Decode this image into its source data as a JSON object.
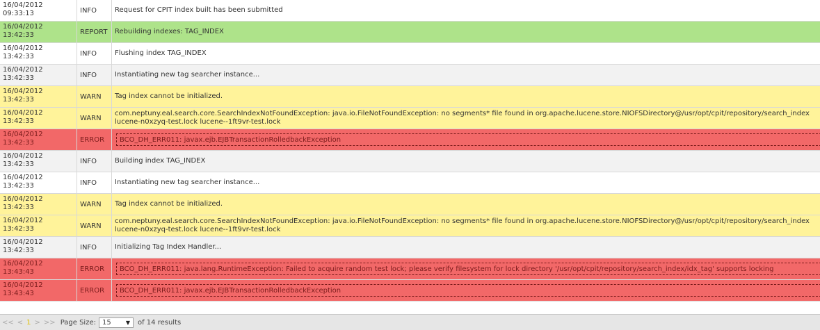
{
  "rows": [
    {
      "date": "16/04/2012",
      "time": "09:33:13",
      "level": "INFO",
      "msg": [
        "Request for CPIT index built has been submitted"
      ]
    },
    {
      "date": "16/04/2012",
      "time": "13:42:33",
      "level": "REPORT",
      "msg": [
        "Rebuilding indexes: TAG_INDEX"
      ]
    },
    {
      "date": "16/04/2012",
      "time": "13:42:33",
      "level": "INFO",
      "msg": [
        "Flushing index TAG_INDEX"
      ]
    },
    {
      "date": "16/04/2012",
      "time": "13:42:33",
      "level": "INFO",
      "msg": [
        "Instantiating new tag searcher instance..."
      ]
    },
    {
      "date": "16/04/2012",
      "time": "13:42:33",
      "level": "WARN",
      "msg": [
        "Tag index cannot be initialized."
      ]
    },
    {
      "date": "16/04/2012",
      "time": "13:42:33",
      "level": "WARN",
      "msg": [
        "com.neptuny.eal.search.core.SearchIndexNotFoundException: java.io.FileNotFoundException: no segments* file found in org.apache.lucene.store.NIOFSDirectory@/usr/opt/cpit/repository/search_index",
        "lucene-n0xzyq-test.lock lucene--1ft9vr-test.lock"
      ]
    },
    {
      "date": "16/04/2012",
      "time": "13:42:33",
      "level": "ERROR",
      "msg": [
        "BCO_DH_ERR011: javax.ejb.EJBTransactionRolledbackException"
      ]
    },
    {
      "date": "16/04/2012",
      "time": "13:42:33",
      "level": "INFO",
      "msg": [
        "Building index TAG_INDEX"
      ]
    },
    {
      "date": "16/04/2012",
      "time": "13:42:33",
      "level": "INFO",
      "msg": [
        "Instantiating new tag searcher instance..."
      ]
    },
    {
      "date": "16/04/2012",
      "time": "13:42:33",
      "level": "WARN",
      "msg": [
        "Tag index cannot be initialized."
      ]
    },
    {
      "date": "16/04/2012",
      "time": "13:42:33",
      "level": "WARN",
      "msg": [
        "com.neptuny.eal.search.core.SearchIndexNotFoundException: java.io.FileNotFoundException: no segments* file found in org.apache.lucene.store.NIOFSDirectory@/usr/opt/cpit/repository/search_index",
        "lucene-n0xzyq-test.lock lucene--1ft9vr-test.lock"
      ]
    },
    {
      "date": "16/04/2012",
      "time": "13:42:33",
      "level": "INFO",
      "msg": [
        "Initializing Tag Index Handler..."
      ]
    },
    {
      "date": "16/04/2012",
      "time": "13:43:43",
      "level": "ERROR",
      "msg": [
        "BCO_DH_ERR011: java.lang.RuntimeException: Failed to acquire random test lock; please verify filesystem for lock directory '/usr/opt/cpit/repository/search_index/idx_tag' supports locking"
      ]
    },
    {
      "date": "16/04/2012",
      "time": "13:43:43",
      "level": "ERROR",
      "msg": [
        "BCO_DH_ERR011: javax.ejb.EJBTransactionRolledbackException"
      ]
    }
  ],
  "pager": {
    "first": "<<",
    "prev": "<",
    "current": "1",
    "next": ">",
    "last": ">>",
    "page_size_label": "Page Size:",
    "page_size_value": "15",
    "results": "of 14 results"
  }
}
